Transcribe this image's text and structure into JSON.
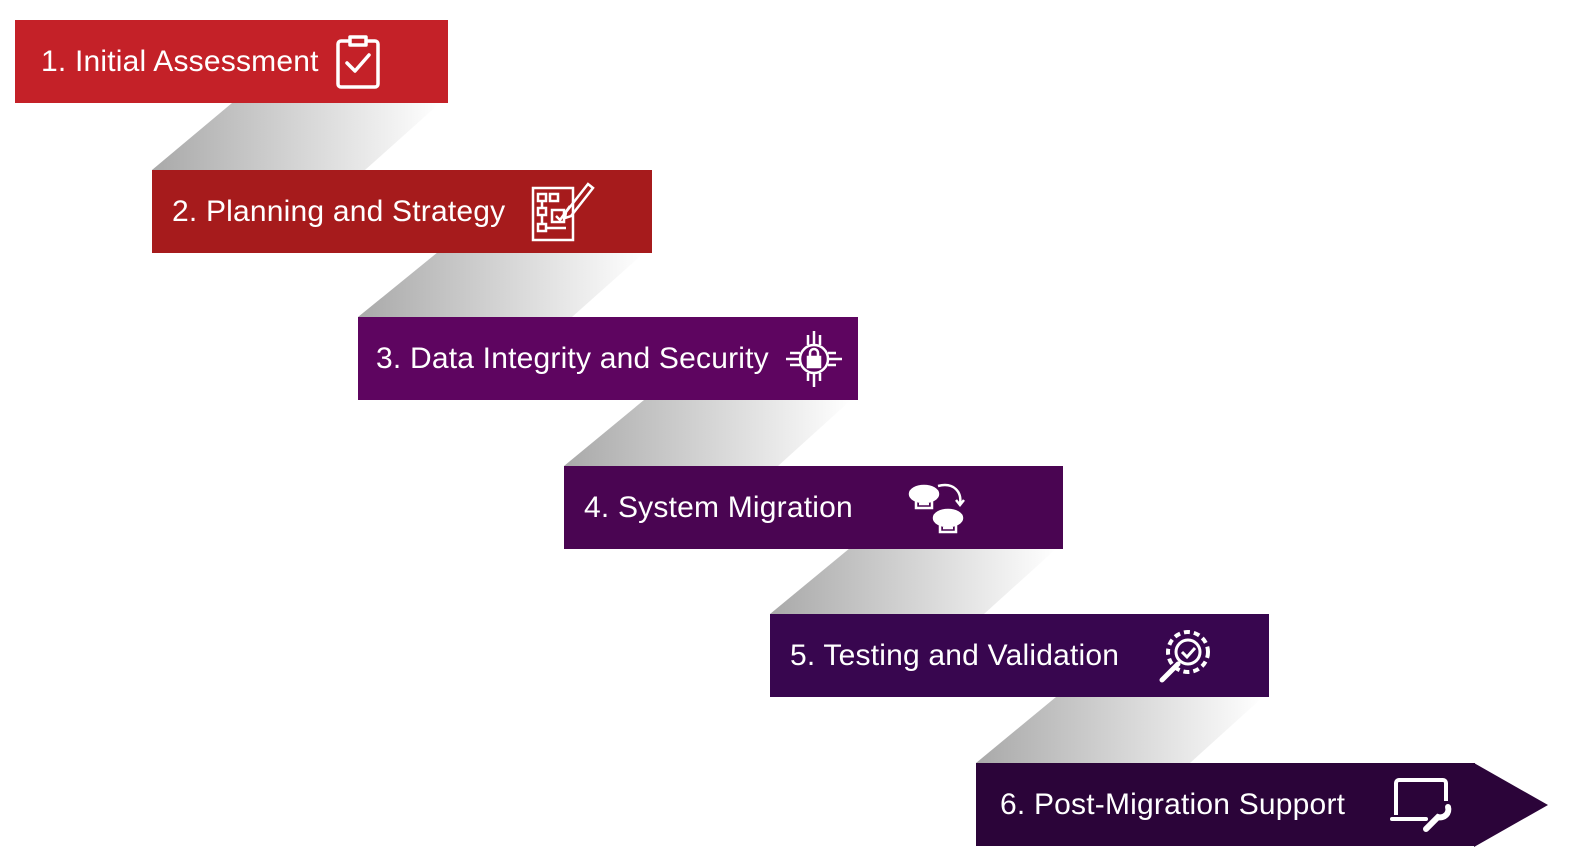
{
  "steps": [
    {
      "label": "1. Initial Assessment",
      "icon": "clipboard-check-icon",
      "color": "#c42128"
    },
    {
      "label": "2. Planning and Strategy",
      "icon": "plan-pencil-icon",
      "color": "#a61b1c"
    },
    {
      "label": "3. Data Integrity and Security",
      "icon": "circuit-lock-icon",
      "color": "#5e0560"
    },
    {
      "label": "4. System Migration",
      "icon": "cloud-server-transfer-icon",
      "color": "#4a0552"
    },
    {
      "label": "5. Testing and Validation",
      "icon": "gear-magnifier-check-icon",
      "color": "#38064f"
    },
    {
      "label": "6. Post-Migration Support",
      "icon": "laptop-wrench-icon",
      "color": "#2b0439"
    }
  ]
}
